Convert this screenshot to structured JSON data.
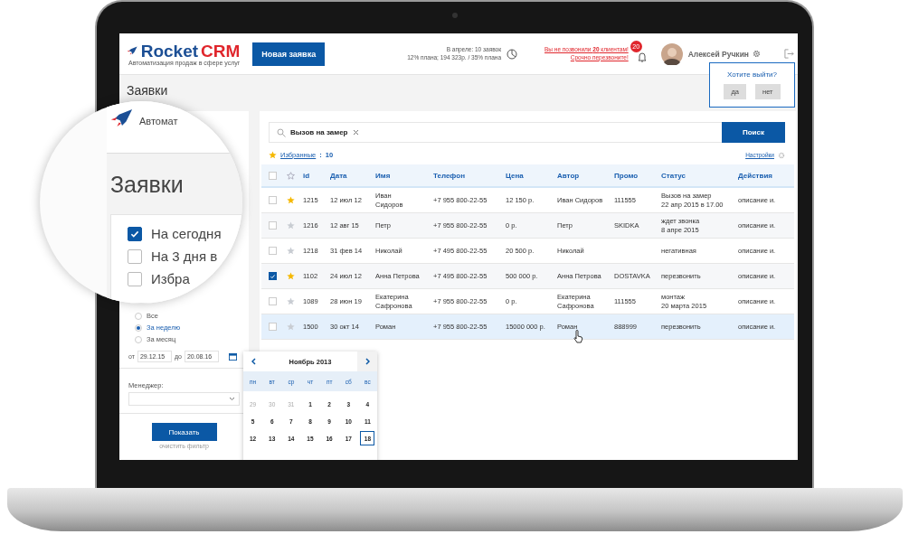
{
  "header": {
    "logo_name": "Rocket",
    "logo_accent": "CRM",
    "tagline": "Автоматизация продаж в сфере услуг",
    "new_button": "Новая заявка",
    "stats": [
      "В апреле: 10 заявок",
      "12% плана; 194 323р. / 35% плана"
    ],
    "alert": [
      "Вы не позвонили **20** клиентам!",
      "Срочно перезвоните!"
    ],
    "notifications_badge": "20",
    "user_name": "Алексей Ручкин"
  },
  "logout_popup": {
    "question": "Хотите выйти?",
    "buttons": [
      "да",
      "нет"
    ]
  },
  "page_title": "Заявки",
  "magnifier": {
    "tagline": "Автомат",
    "title": "Заявки",
    "filters": [
      {
        "label": "На сегодня",
        "checked": true
      },
      {
        "label": "На 3 дня в",
        "checked": false
      },
      {
        "label": "Избра",
        "checked": false
      }
    ]
  },
  "sidebar": {
    "periods": [
      {
        "label": "Все",
        "selected": false
      },
      {
        "label": "За неделю",
        "selected": true
      },
      {
        "label": "За месяц",
        "selected": false
      }
    ],
    "from_label": "от",
    "from": "29.12.15",
    "to_label": "до",
    "to": "20.08.16",
    "manager_label": "Менеджер:",
    "show_button": "Показать",
    "clear_link": "очистить фильтр"
  },
  "search": {
    "value": "Вызов на замер",
    "button": "Поиск"
  },
  "favorites": {
    "label": "Избранные",
    "separator": ":",
    "count": "10"
  },
  "settings_link": "Настройки",
  "table": {
    "select_all": {
      "checked": false
    },
    "columns": [
      "id",
      "Дата",
      "Имя",
      "Телефон",
      "Цена",
      "Автор",
      "Промо",
      "Статус",
      "Действия"
    ],
    "rows": [
      {
        "checked": false,
        "starred": true,
        "highlighted": false,
        "cells": [
          "1215",
          "12 июл 12",
          "Иван\nСидоров",
          "+7 955 800-22-55",
          "12 150 р.",
          "Иван Сидоров",
          "111555",
          "Вызов на замер\n22 апр 2015 в 17.00",
          "описание и."
        ]
      },
      {
        "checked": false,
        "starred": false,
        "highlighted": false,
        "cells": [
          "1216",
          "12 авг 15",
          "Петр",
          "+7 955 800-22-55",
          "0 р.",
          "Петр",
          "SKIDKA",
          "ждет звонка\n8 апре 2015",
          "описание и."
        ]
      },
      {
        "checked": false,
        "starred": false,
        "highlighted": false,
        "cells": [
          "1218",
          "31 фев 14",
          "Николай",
          "+7 495 800-22-55",
          "20 500 р.",
          "Николай",
          "",
          "негативная",
          "описание и."
        ]
      },
      {
        "checked": true,
        "starred": true,
        "highlighted": false,
        "cells": [
          "1102",
          "24 июл 12",
          "Анна Петрова",
          "+7 495 800-22-55",
          "500 000 р.",
          "Анна Петрова",
          "DOSTAVKA",
          "перезвонить",
          "описание и."
        ]
      },
      {
        "checked": false,
        "starred": false,
        "highlighted": false,
        "cells": [
          "1089",
          "28 июн 19",
          "Екатерина\nСафронова",
          "+7 955 800-22-55",
          "0 р.",
          "Екатерина\nСафронова",
          "111555",
          "монтаж\n20 марта 2015",
          "описание и."
        ]
      },
      {
        "checked": false,
        "starred": false,
        "highlighted": true,
        "cells": [
          "1500",
          "30 окт 14",
          "Роман",
          "+7 955 800-22-55",
          "15000 000 р.",
          "Роман",
          "888999",
          "перезвонить",
          "описание и."
        ]
      }
    ]
  },
  "calendar": {
    "title": "Ноябрь 2013",
    "weekdays": [
      "пн",
      "вт",
      "ср",
      "чт",
      "пт",
      "сб",
      "вс"
    ],
    "days": [
      {
        "label": "29",
        "muted": true,
        "today": false
      },
      {
        "label": "30",
        "muted": true,
        "today": false
      },
      {
        "label": "31",
        "muted": true,
        "today": false
      },
      {
        "label": "1",
        "muted": false,
        "today": false
      },
      {
        "label": "2",
        "muted": false,
        "today": false
      },
      {
        "label": "3",
        "muted": false,
        "today": false
      },
      {
        "label": "4",
        "muted": false,
        "today": false
      },
      {
        "label": "5",
        "muted": false,
        "today": false
      },
      {
        "label": "6",
        "muted": false,
        "today": false
      },
      {
        "label": "7",
        "muted": false,
        "today": false
      },
      {
        "label": "8",
        "muted": false,
        "today": false
      },
      {
        "label": "9",
        "muted": false,
        "today": false
      },
      {
        "label": "10",
        "muted": false,
        "today": false
      },
      {
        "label": "11",
        "muted": false,
        "today": false
      },
      {
        "label": "12",
        "muted": false,
        "today": false
      },
      {
        "label": "13",
        "muted": false,
        "today": false
      },
      {
        "label": "14",
        "muted": false,
        "today": false
      },
      {
        "label": "15",
        "muted": false,
        "today": false
      },
      {
        "label": "16",
        "muted": false,
        "today": false
      },
      {
        "label": "17",
        "muted": false,
        "today": false
      },
      {
        "label": "18",
        "muted": false,
        "today": true
      }
    ]
  }
}
